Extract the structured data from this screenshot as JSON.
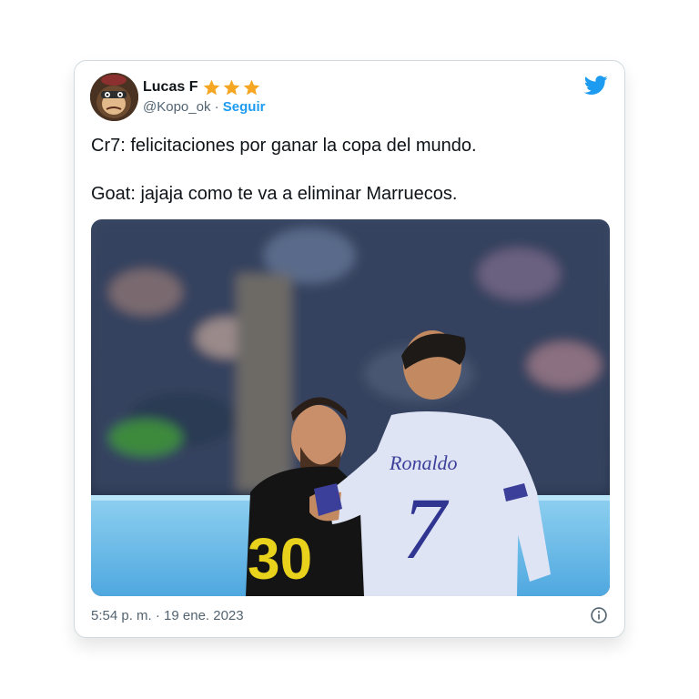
{
  "tweet": {
    "author": {
      "display_name": "Lucas F",
      "badges": [
        "star-icon",
        "star-icon",
        "star-icon"
      ],
      "handle": "@Kopo_ok",
      "separator": "·",
      "follow_label": "Seguir"
    },
    "text_lines": [
      "Cr7: felicitaciones por ganar la copa del mundo.",
      "Goat: jajaja como te va a eliminar Marruecos."
    ],
    "media": {
      "jersey_name": "Ronaldo",
      "jersey_number": "7",
      "shorts_number": "30"
    },
    "timestamp": "5:54 p. m. · 19 ene. 2023",
    "icons": [
      "twitter-bird-icon",
      "info-icon"
    ]
  },
  "colors": {
    "accent": "#1d9bf0",
    "star": "#f5a623",
    "text": "#0f1419",
    "muted": "#536471",
    "border": "#cfd9de"
  }
}
